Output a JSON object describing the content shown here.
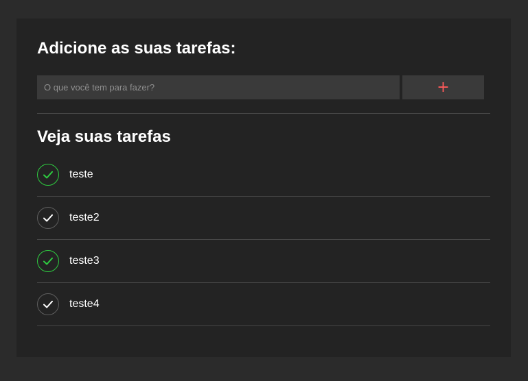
{
  "header": {
    "title": "Adicione as suas tarefas:"
  },
  "form": {
    "input_value": "",
    "input_placeholder": "O que você tem para fazer?",
    "add_label": "+"
  },
  "list": {
    "title": "Veja suas tarefas",
    "items": [
      {
        "label": "teste",
        "done": true
      },
      {
        "label": "teste2",
        "done": false
      },
      {
        "label": "teste3",
        "done": true
      },
      {
        "label": "teste4",
        "done": false
      }
    ]
  },
  "colors": {
    "page_background": "#2b2b2b",
    "card_background": "#232323",
    "input_background": "#3a3a3a",
    "add_button_plus": "#ff5a5a",
    "done_check": "#2ecc40",
    "pending_check": "#ffffff",
    "pending_border": "#5e5e5e"
  }
}
